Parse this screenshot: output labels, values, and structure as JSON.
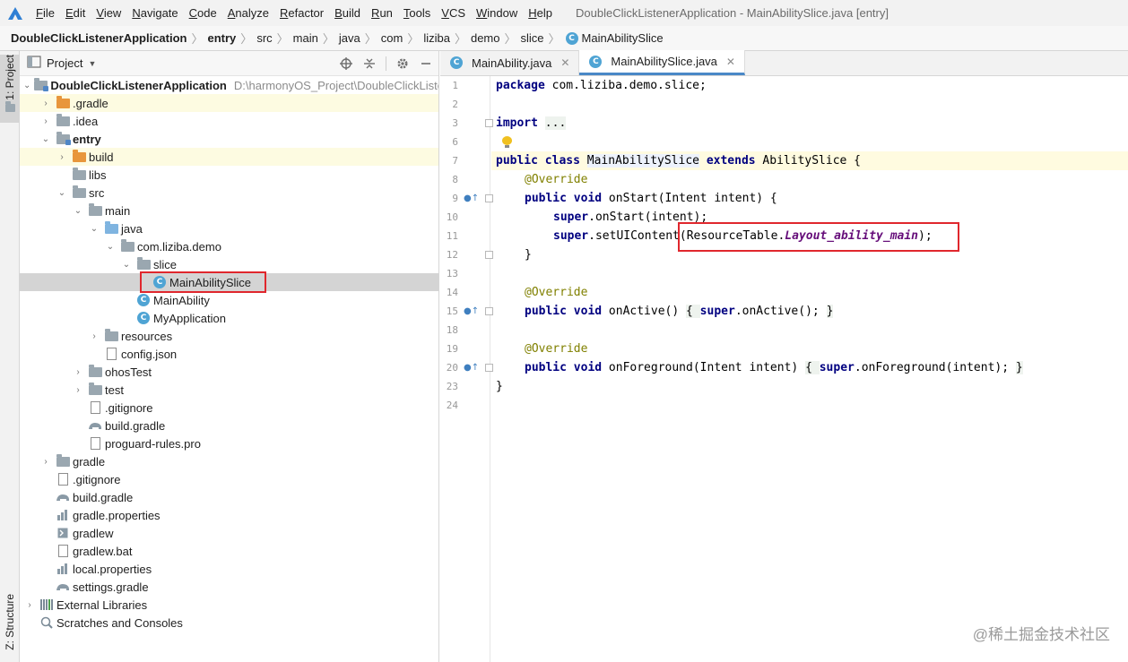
{
  "menubar": {
    "items": [
      "File",
      "Edit",
      "View",
      "Navigate",
      "Code",
      "Analyze",
      "Refactor",
      "Build",
      "Run",
      "Tools",
      "VCS",
      "Window",
      "Help"
    ],
    "window_title": "DoubleClickListenerApplication - MainAbilitySlice.java [entry]"
  },
  "breadcrumb": [
    "DoubleClickListenerApplication",
    "entry",
    "src",
    "main",
    "java",
    "com",
    "liziba",
    "demo",
    "slice",
    "MainAbilitySlice"
  ],
  "toolstrip": {
    "project_tab": "1: Project",
    "structure_tab": "Z: Structure"
  },
  "project_panel": {
    "title": "Project",
    "tree": [
      {
        "label": "DoubleClickListenerApplication",
        "path": "D:\\harmonyOS_Project\\DoubleClickListe"
      },
      {
        "label": ".gradle"
      },
      {
        "label": ".idea"
      },
      {
        "label": "entry"
      },
      {
        "label": "build"
      },
      {
        "label": "libs"
      },
      {
        "label": "src"
      },
      {
        "label": "main"
      },
      {
        "label": "java"
      },
      {
        "label": "com.liziba.demo"
      },
      {
        "label": "slice"
      },
      {
        "label": "MainAbilitySlice"
      },
      {
        "label": "MainAbility"
      },
      {
        "label": "MyApplication"
      },
      {
        "label": "resources"
      },
      {
        "label": "config.json"
      },
      {
        "label": "ohosTest"
      },
      {
        "label": "test"
      },
      {
        "label": ".gitignore"
      },
      {
        "label": "build.gradle"
      },
      {
        "label": "proguard-rules.pro"
      },
      {
        "label": "gradle"
      },
      {
        "label": ".gitignore"
      },
      {
        "label": "build.gradle"
      },
      {
        "label": "gradle.properties"
      },
      {
        "label": "gradlew"
      },
      {
        "label": "gradlew.bat"
      },
      {
        "label": "local.properties"
      },
      {
        "label": "settings.gradle"
      },
      {
        "label": "External Libraries"
      },
      {
        "label": "Scratches and Consoles"
      }
    ]
  },
  "editor": {
    "tabs": [
      {
        "label": "MainAbility.java"
      },
      {
        "label": "MainAbilitySlice.java"
      }
    ],
    "line_numbers": [
      "1",
      "2",
      "3",
      "6",
      "7",
      "8",
      "9",
      "10",
      "11",
      "12",
      "13",
      "14",
      "15",
      "18",
      "19",
      "20",
      "23",
      "24"
    ],
    "code": {
      "l1_kw": "package",
      "l1_rest": " com.liziba.demo.slice;",
      "l3_kw": "import",
      "l3_rest": "...",
      "l7_kw1": "public class",
      "l7_name": "MainAbilitySlice",
      "l7_kw2": "extends",
      "l7_rest": " AbilitySlice {",
      "l8_an": "@Override",
      "l9_kw": "public void",
      "l9_rest": " onStart(Intent intent) {",
      "l10_kw": "super",
      "l10_rest": ".onStart(intent);",
      "l11_kw": "super",
      "l11_rest": ".setUIContent(ResourceTable.",
      "l11_it": "Layout_ability_main",
      "l11_end": ");",
      "l12": "}",
      "l14_an": "@Override",
      "l15_kw": "public void",
      "l15_rest": " onActive() ",
      "l15_b1": "{ ",
      "l15_kw2": "super",
      "l15_rest2": ".onActive(); ",
      "l15_b2": "}",
      "l19_an": "@Override",
      "l20_kw": "public void",
      "l20_rest": " onForeground(Intent intent) ",
      "l20_b1": "{ ",
      "l20_kw2": "super",
      "l20_rest2": ".onForeground(intent); ",
      "l20_b2": "}",
      "l23": "}"
    }
  },
  "watermark": "@稀土掘金技术社区",
  "colors": {
    "highlight_box": "#e0272d",
    "keyword": "#000080",
    "annotation": "#808000",
    "constant": "#660e7a"
  }
}
